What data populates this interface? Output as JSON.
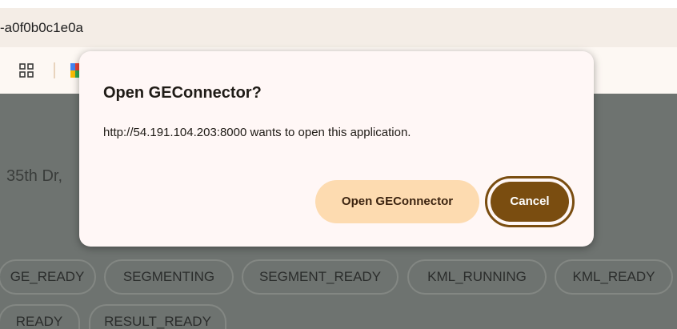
{
  "browser": {
    "address_text": "-a0f0b0c1e0a",
    "apps_icon": "apps-grid-icon"
  },
  "page": {
    "address_fragment": "35th Dr,",
    "status_chips_row1": [
      "GE_READY",
      "SEGMENTING",
      "SEGMENT_READY",
      "KML_RUNNING",
      "KML_READY"
    ],
    "status_chips_row2": [
      "READY",
      "RESULT_READY"
    ]
  },
  "dialog": {
    "title": "Open GEConnector?",
    "message": "http://54.191.104.203:8000 wants to open this application.",
    "open_button": "Open GEConnector",
    "cancel_button": "Cancel"
  },
  "colors": {
    "overlay": "#6e7370",
    "dialog_bg": "#fff7f6",
    "open_button_bg": "#fddbb0",
    "cancel_button_bg": "#7a4d10"
  }
}
